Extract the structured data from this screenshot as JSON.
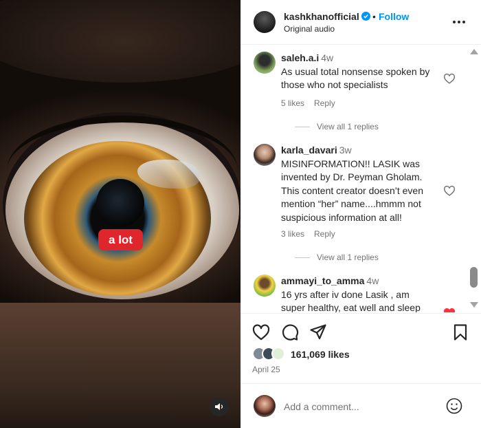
{
  "media": {
    "caption_overlay": "a lot",
    "mute_icon": "speaker-icon"
  },
  "header": {
    "username": "kashkhanofficial",
    "verified": true,
    "separator": "•",
    "follow_label": "Follow",
    "audio_label": "Original audio",
    "more_icon": "more-options-icon"
  },
  "comments": [
    {
      "username": "saleh.a.i",
      "time": "4w",
      "text": "As usual total nonsense spoken by those who not specialists",
      "likes": "5 likes",
      "reply": "Reply",
      "view_replies": "View all 1 replies",
      "liked": false
    },
    {
      "username": "karla_davari",
      "time": "3w",
      "text": "MISINFORMATION!! LASIK was invented by Dr. Peyman Gholam. This content creator doesn’t even mention “her” name....hmmm not suspicious information at all!",
      "likes": "3 likes",
      "reply": "Reply",
      "view_replies": "View all 1 replies",
      "liked": false
    },
    {
      "username": "ammayi_to_amma",
      "time": "4w",
      "text": "16 yrs after iv done Lasik , am super healthy, eat well and sleep",
      "liked": true
    }
  ],
  "actions": {
    "like_icon": "heart-icon",
    "comment_icon": "comment-icon",
    "share_icon": "share-icon",
    "save_icon": "bookmark-icon"
  },
  "likes": {
    "count": "161,069 likes"
  },
  "post_date": "April 25",
  "comment_box": {
    "placeholder": "Add a comment...",
    "emoji_icon": "emoji-icon"
  },
  "colors": {
    "accent": "#0095f6",
    "caption_red": "#e0262d",
    "liked_red": "#ff3040",
    "muted_text": "#737373"
  }
}
